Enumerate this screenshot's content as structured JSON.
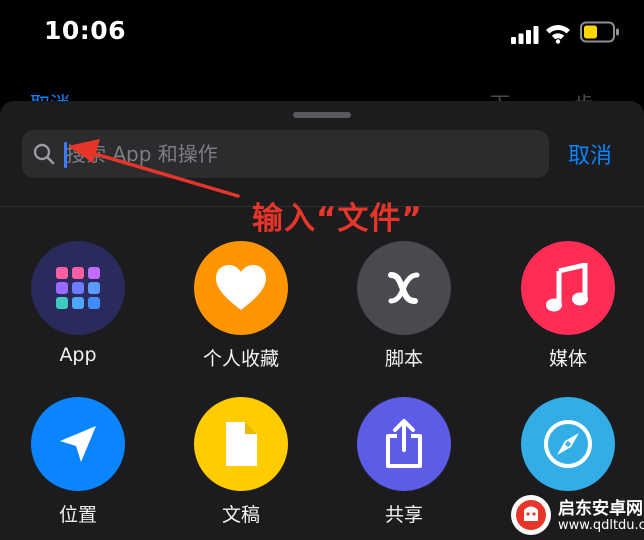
{
  "status_bar": {
    "time": "10:06"
  },
  "background_sheet": {
    "cancel_label": "取消",
    "next_label": "下一步"
  },
  "search": {
    "placeholder": "搜索 App 和操作",
    "value": "",
    "cancel_label": "取消"
  },
  "annotation": {
    "text": "输入“文件”",
    "color": "#e8352a"
  },
  "categories": [
    {
      "label": "App",
      "icon": "app-grid-icon",
      "color": "#2a2a5c"
    },
    {
      "label": "个人收藏",
      "icon": "heart-icon",
      "color": "#ff9500"
    },
    {
      "label": "脚本",
      "icon": "script-x-icon",
      "color": "#4a4a4e"
    },
    {
      "label": "媒体",
      "icon": "music-note-icon",
      "color": "#ff2d55"
    },
    {
      "label": "位置",
      "icon": "location-arrow-icon",
      "color": "#0a84ff"
    },
    {
      "label": "文稿",
      "icon": "document-icon",
      "color": "#ffcc00"
    },
    {
      "label": "共享",
      "icon": "share-icon",
      "color": "#5e5ce6"
    },
    {
      "label": "",
      "icon": "compass-icon",
      "color": "#32ade6"
    }
  ],
  "watermark": {
    "title": "启东安卓网",
    "url": "www.qdltdu.com"
  }
}
